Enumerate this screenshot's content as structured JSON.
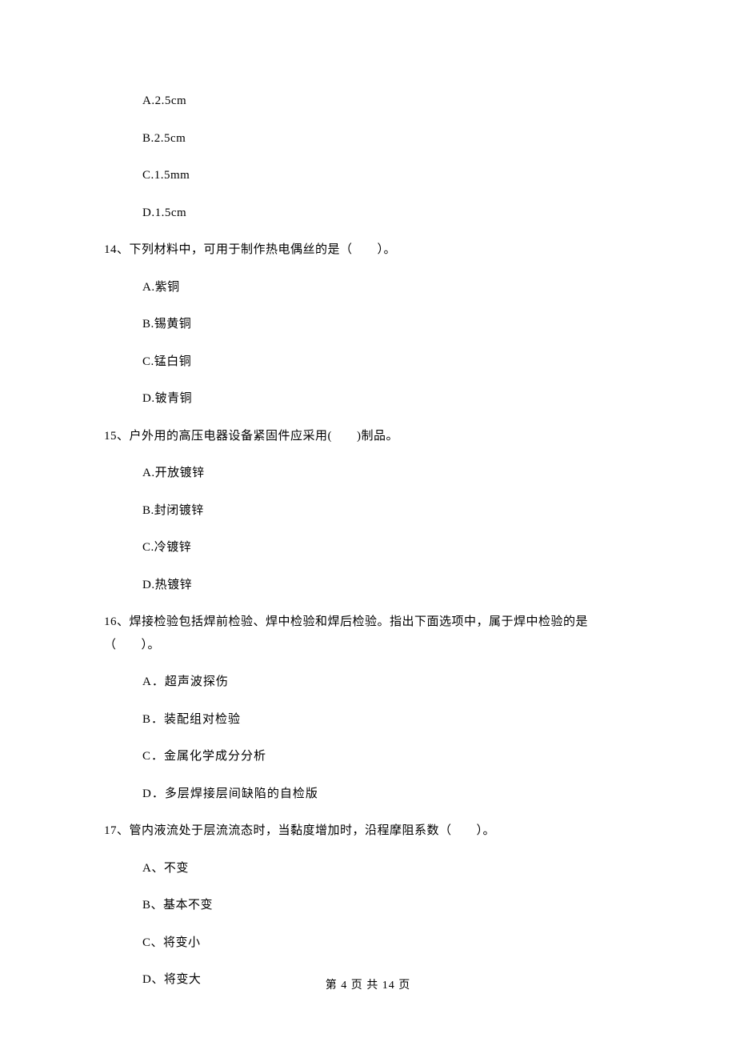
{
  "q13_options": {
    "a": "A.2.5cm",
    "b": "B.2.5cm",
    "c": "C.1.5mm",
    "d": "D.1.5cm"
  },
  "q14": {
    "text": "14、下列材料中，可用于制作热电偶丝的是（　　）。",
    "options": {
      "a": "A.紫铜",
      "b": "B.锡黄铜",
      "c": "C.锰白铜",
      "d": "D.铍青铜"
    }
  },
  "q15": {
    "text": "15、户外用的高压电器设备紧固件应采用(　　)制品。",
    "options": {
      "a": "A.开放镀锌",
      "b": "B.封闭镀锌",
      "c": "C.冷镀锌",
      "d": "D.热镀锌"
    }
  },
  "q16": {
    "text_line1": "16、焊接检验包括焊前检验、焊中检验和焊后检验。指出下面选项中，属于焊中检验的是",
    "text_line2": "（　　）。",
    "options": {
      "a": "A．超声波探伤",
      "b": "B．装配组对检验",
      "c": "C．金属化学成分分析",
      "d": "D．多层焊接层间缺陷的自检版"
    }
  },
  "q17": {
    "text": "17、管内液流处于层流流态时，当黏度增加时，沿程摩阻系数（　　）。",
    "options": {
      "a": "A、不变",
      "b": "B、基本不变",
      "c": "C、将变小",
      "d": "D、将变大"
    }
  },
  "footer": "第 4 页 共 14 页"
}
